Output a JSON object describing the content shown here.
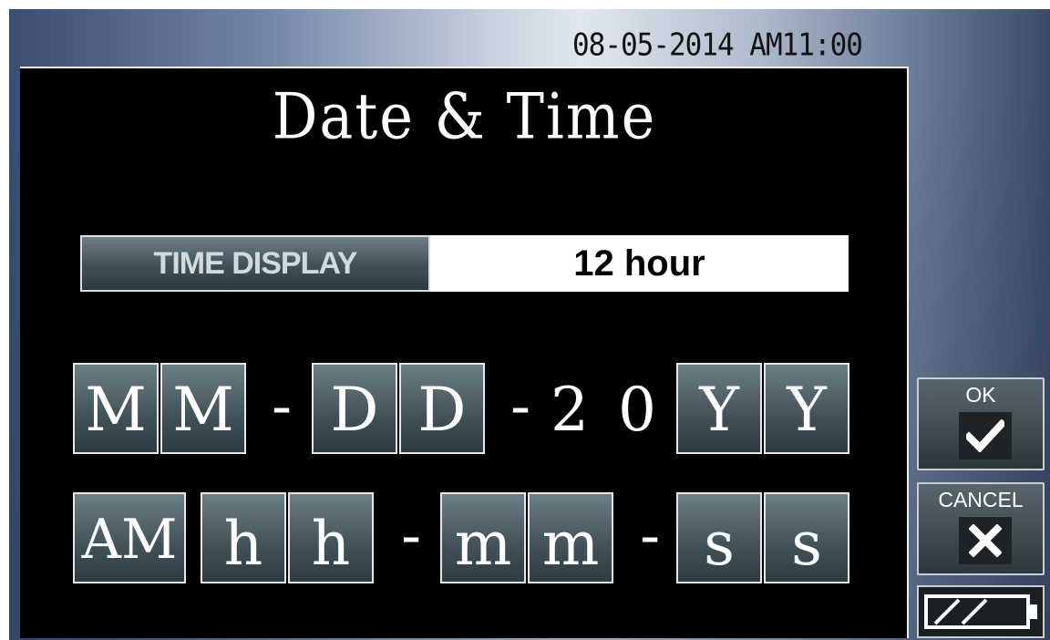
{
  "status": {
    "datetime": "08-05-2014 AM11:00"
  },
  "screen": {
    "title": "Date & Time",
    "time_display": {
      "label": "TIME DISPLAY",
      "value": "12 hour"
    }
  },
  "date_row": {
    "month": [
      "M",
      "M"
    ],
    "sep1": "-",
    "day": [
      "D",
      "D"
    ],
    "sep2": "-",
    "century": [
      "2",
      "0"
    ],
    "year": [
      "Y",
      "Y"
    ]
  },
  "time_row": {
    "ampm": "AM",
    "hour": [
      "h",
      "h"
    ],
    "sep1": "-",
    "minute": [
      "m",
      "m"
    ],
    "sep2": "-",
    "second": [
      "s",
      "s"
    ]
  },
  "buttons": {
    "ok": "OK",
    "cancel": "CANCEL"
  },
  "icons": {
    "ok": "checkmark-icon",
    "cancel": "x-icon",
    "battery": "battery-icon"
  },
  "battery": {
    "level": 0.66
  }
}
